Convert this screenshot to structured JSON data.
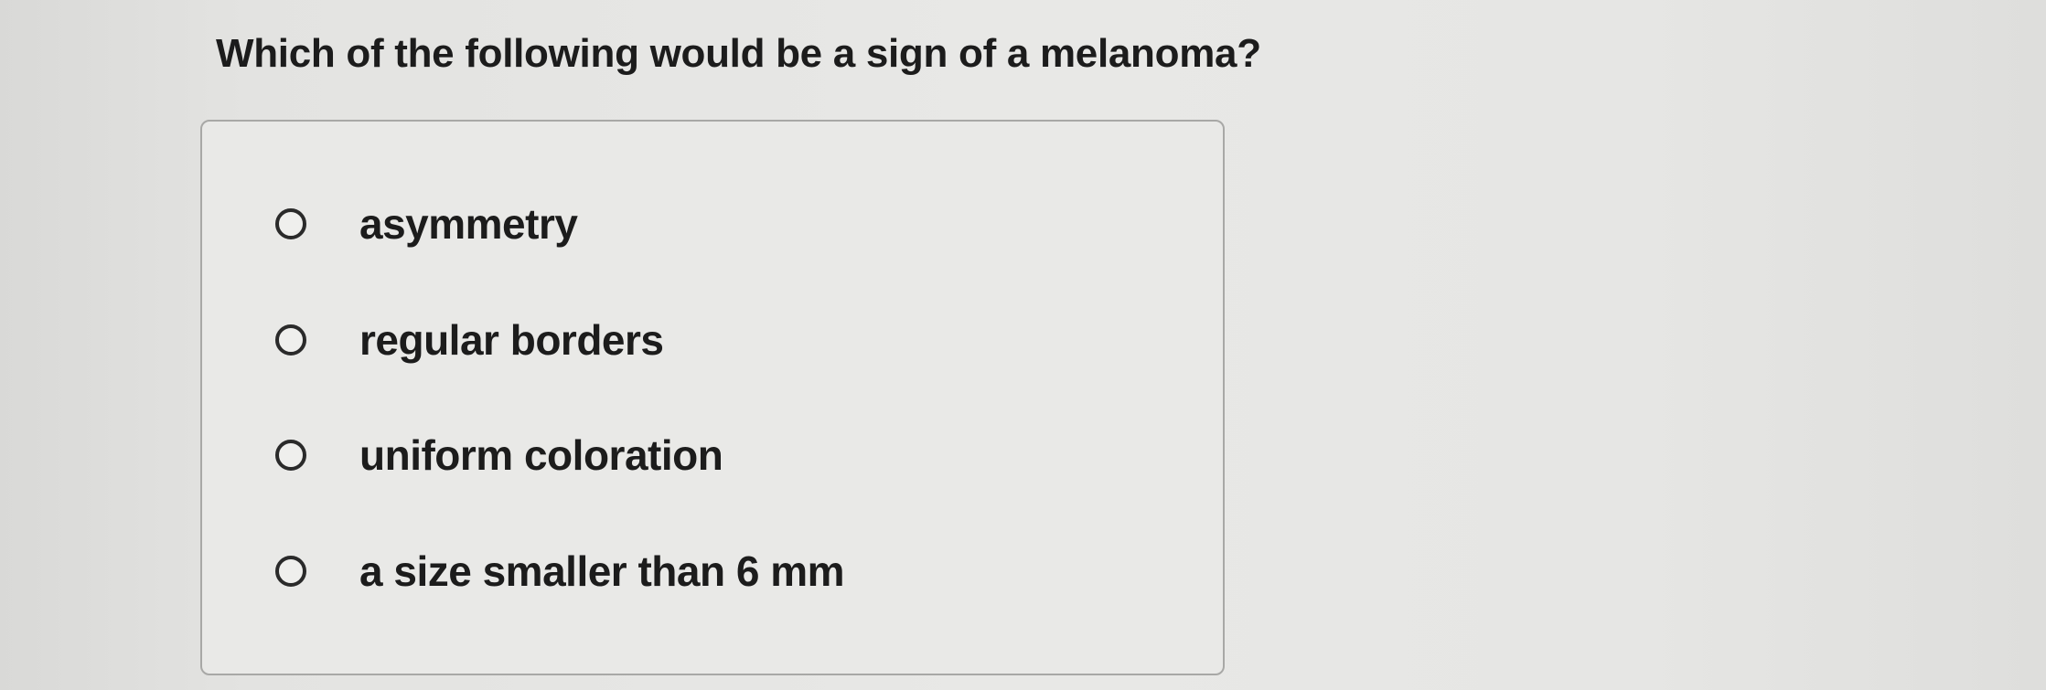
{
  "question": {
    "text": "Which of the following would be a sign of a melanoma?"
  },
  "options": [
    {
      "label": "asymmetry",
      "selected": false
    },
    {
      "label": "regular borders",
      "selected": false
    },
    {
      "label": "uniform coloration",
      "selected": false
    },
    {
      "label": "a size smaller than 6 mm",
      "selected": false
    }
  ]
}
